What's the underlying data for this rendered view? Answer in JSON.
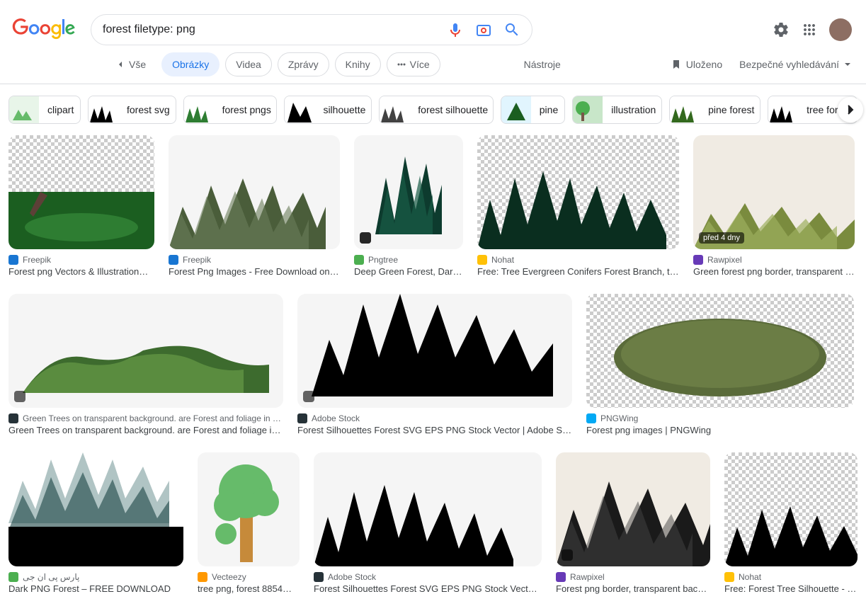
{
  "search": {
    "query": "forest filetype: png"
  },
  "nav": {
    "all": "Vše",
    "images": "Obrázky",
    "videos": "Videa",
    "news": "Zprávy",
    "books": "Knihy",
    "more": "Více",
    "tools": "Nástroje",
    "saved": "Uloženo",
    "safesearch": "Bezpečné vyhledávání"
  },
  "chips": [
    {
      "label": "clipart"
    },
    {
      "label": "forest svg"
    },
    {
      "label": "forest pngs"
    },
    {
      "label": "silhouette"
    },
    {
      "label": "forest silhouette"
    },
    {
      "label": "pine"
    },
    {
      "label": "illustration"
    },
    {
      "label": "pine forest"
    },
    {
      "label": "tree forest"
    }
  ],
  "results_row1": [
    {
      "source": "Freepik",
      "title": "Forest png Vectors & Illustration…",
      "favicon": "#1976d2"
    },
    {
      "source": "Freepik",
      "title": "Forest Png Images - Free Download on …",
      "favicon": "#1976d2"
    },
    {
      "source": "Pngtree",
      "title": "Deep Green Forest, Dark…",
      "favicon": "#4caf50"
    },
    {
      "source": "Nohat",
      "title": "Free: Tree Evergreen Conifers Forest Branch, tr…",
      "favicon": "#ffc107"
    },
    {
      "source": "Rawpixel",
      "title": "Green forest png border, transparent …",
      "favicon": "#673ab7",
      "badge_time": "před 4 dny"
    }
  ],
  "results_row2": [
    {
      "source": "Green Trees on transparent background. are Forest and foliage in summ…",
      "title": "Green Trees on transparent background. are Forest and foliage i…",
      "favicon": "#263238"
    },
    {
      "source": "Adobe Stock",
      "title": "Forest Silhouettes Forest SVG EPS PNG Stock Vector | Adobe St…",
      "favicon": "#263238"
    },
    {
      "source": "PNGWing",
      "title": "Forest png images | PNGWing",
      "favicon": "#03a9f4"
    }
  ],
  "results_row3": [
    {
      "source": "پارس پی ان جی",
      "title": "Dark PNG Forest – FREE DOWNLOAD",
      "favicon": "#4caf50"
    },
    {
      "source": "Vecteezy",
      "title": "tree png, forest 8854…",
      "favicon": "#ff9800"
    },
    {
      "source": "Adobe Stock",
      "title": "Forest Silhouettes Forest SVG EPS PNG Stock Vector …",
      "favicon": "#263238"
    },
    {
      "source": "Rawpixel",
      "title": "Forest png border, transparent back…",
      "favicon": "#673ab7"
    },
    {
      "source": "Nohat",
      "title": "Free: Forest Tree Silhouette - …",
      "favicon": "#ffc107"
    }
  ]
}
